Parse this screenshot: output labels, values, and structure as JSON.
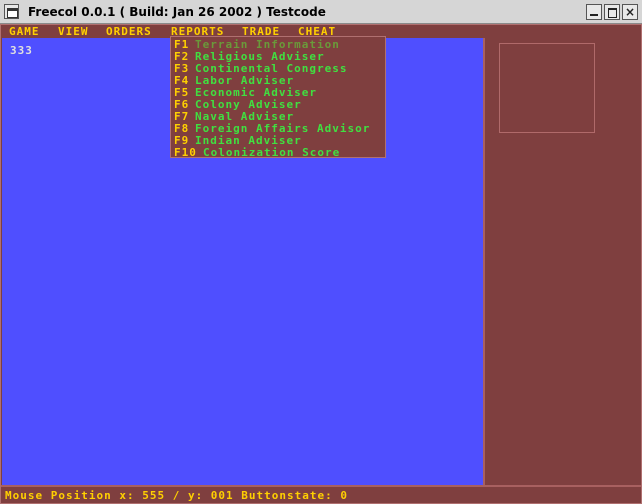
{
  "window": {
    "title": "Freecol 0.0.1 ( Build: Jan 26 2002 ) Testcode",
    "close_glyph": "×"
  },
  "menubar": {
    "items": [
      "GAME",
      "VIEW",
      "ORDERS",
      "REPORTS",
      "TRADE",
      "CHEAT"
    ],
    "open_menu": "REPORTS"
  },
  "reports_menu": {
    "items": [
      {
        "key": "F1",
        "label": "Terrain Information"
      },
      {
        "key": "F2",
        "label": "Religious Adviser"
      },
      {
        "key": "F3",
        "label": "Continental Congress"
      },
      {
        "key": "F4",
        "label": "Labor Adviser"
      },
      {
        "key": "F5",
        "label": "Economic Adviser"
      },
      {
        "key": "F6",
        "label": "Colony Adviser"
      },
      {
        "key": "F7",
        "label": "Naval Adviser"
      },
      {
        "key": "F8",
        "label": "Foreign Affairs Advisor"
      },
      {
        "key": "F9",
        "label": "Indian Adviser"
      },
      {
        "key": "F10",
        "label": "Colonization Score"
      }
    ]
  },
  "map": {
    "value": "333"
  },
  "status": {
    "text": "Mouse Position x: 555 / y: 001 Buttonstate: 0"
  },
  "colors": {
    "map_background": "#4f4fff",
    "panel_background": "#7f3f3f",
    "menu_text": "#ffd000",
    "menu_item_text": "#40e040"
  }
}
